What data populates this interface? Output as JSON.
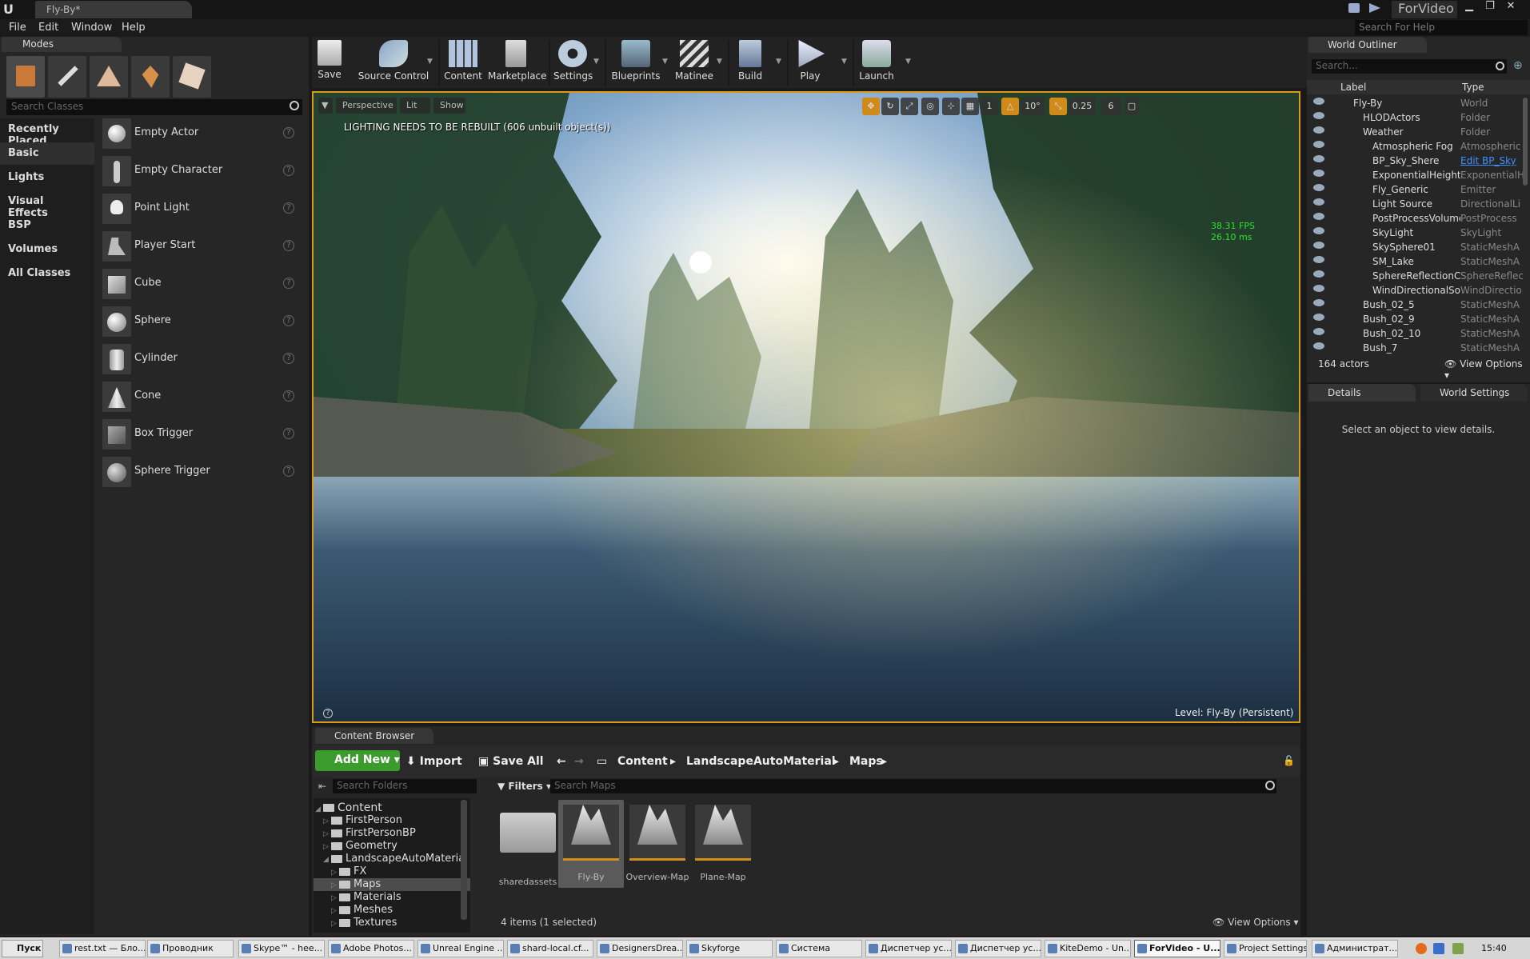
{
  "window": {
    "doc_tab": "Fly-By*",
    "project": "ForVideo"
  },
  "menu": {
    "items": [
      "File",
      "Edit",
      "Window",
      "Help"
    ],
    "search_placeholder": "Search For Help"
  },
  "modes": {
    "tab": "Modes",
    "search_placeholder": "Search Classes",
    "categories": [
      "Recently Placed",
      "Basic",
      "Lights",
      "Visual Effects",
      "BSP",
      "Volumes",
      "All Classes"
    ],
    "active_category": "Basic",
    "actors": [
      "Empty Actor",
      "Empty Character",
      "Point Light",
      "Player Start",
      "Cube",
      "Sphere",
      "Cylinder",
      "Cone",
      "Box Trigger",
      "Sphere Trigger"
    ]
  },
  "toolbar": {
    "save": "Save",
    "source_control": "Source Control",
    "content": "Content",
    "marketplace": "Marketplace",
    "settings": "Settings",
    "blueprints": "Blueprints",
    "matinee": "Matinee",
    "build": "Build",
    "play": "Play",
    "launch": "Launch"
  },
  "viewport": {
    "perspective": "Perspective",
    "lit": "Lit",
    "show": "Show",
    "warning": "LIGHTING NEEDS TO BE REBUILT (606 unbuilt object(s))",
    "fps": "38.31 FPS",
    "ms": "26.10 ms",
    "level_prefix": "Level:",
    "level_name": "Fly-By (Persistent)",
    "rotate_snap": "10°",
    "scale_snap": "0.25",
    "camera_speed": "6"
  },
  "content_browser": {
    "tab": "Content Browser",
    "add_new": "Add New",
    "import": "Import",
    "save_all": "Save All",
    "breadcrumbs": [
      "Content",
      "LandscapeAutoMaterial",
      "Maps"
    ],
    "folder_search_placeholder": "Search Folders",
    "filters": "Filters",
    "asset_search_placeholder": "Search Maps",
    "tree_root": "Content",
    "tree": [
      "FirstPerson",
      "FirstPersonBP",
      "Geometry",
      "LandscapeAutoMaterial",
      "FX",
      "Maps",
      "Materials",
      "Meshes",
      "Textures"
    ],
    "assets": [
      "sharedassets",
      "Fly-By",
      "Overview-Map",
      "Plane-Map"
    ],
    "count": "4 items (1 selected)",
    "view_options": "View Options"
  },
  "outliner": {
    "tab": "World Outliner",
    "search_placeholder": "Search...",
    "col_label": "Label",
    "col_type": "Type",
    "rows": [
      {
        "label": "Fly-By",
        "type": "World"
      },
      {
        "label": "HLODActors",
        "type": "Folder"
      },
      {
        "label": "Weather",
        "type": "Folder"
      },
      {
        "label": "Atmospheric Fog",
        "type": "Atmospheric"
      },
      {
        "label": "BP_Sky_Shere",
        "type": "Edit BP_Sky"
      },
      {
        "label": "ExponentialHeightFog",
        "type": "ExponentialH"
      },
      {
        "label": "Fly_Generic",
        "type": "Emitter"
      },
      {
        "label": "Light Source",
        "type": "DirectionalLi"
      },
      {
        "label": "PostProcessVolume",
        "type": "PostProcess"
      },
      {
        "label": "SkyLight",
        "type": "SkyLight"
      },
      {
        "label": "SkySphere01",
        "type": "StaticMeshA"
      },
      {
        "label": "SM_Lake",
        "type": "StaticMeshA"
      },
      {
        "label": "SphereReflectionCapture",
        "type": "SphereReflec"
      },
      {
        "label": "WindDirectionalSource",
        "type": "WindDirectio"
      },
      {
        "label": "Bush_02_5",
        "type": "StaticMeshA"
      },
      {
        "label": "Bush_02_9",
        "type": "StaticMeshA"
      },
      {
        "label": "Bush_02_10",
        "type": "StaticMeshA"
      },
      {
        "label": "Bush_7",
        "type": "StaticMeshA"
      }
    ],
    "count": "164 actors",
    "view_options": "View Options"
  },
  "details": {
    "tab": "Details",
    "world_settings": "World Settings",
    "empty_msg": "Select an object to view details."
  },
  "taskbar": {
    "start": "Пуск",
    "tasks": [
      "rest.txt — Бло...",
      "Проводник",
      "Skype™ - hee...",
      "Adobe Photos...",
      "Unreal Engine ...",
      "shard-local.cf...",
      "DesignersDrea...",
      "Skyforge",
      "Система",
      "Диспетчер ус...",
      "Диспетчер ус...",
      "KiteDemo - Un...",
      "ForVideo - U...",
      "Project Settings",
      "Администрат..."
    ],
    "active_task": "ForVideo - U...",
    "clock": "15:40"
  }
}
